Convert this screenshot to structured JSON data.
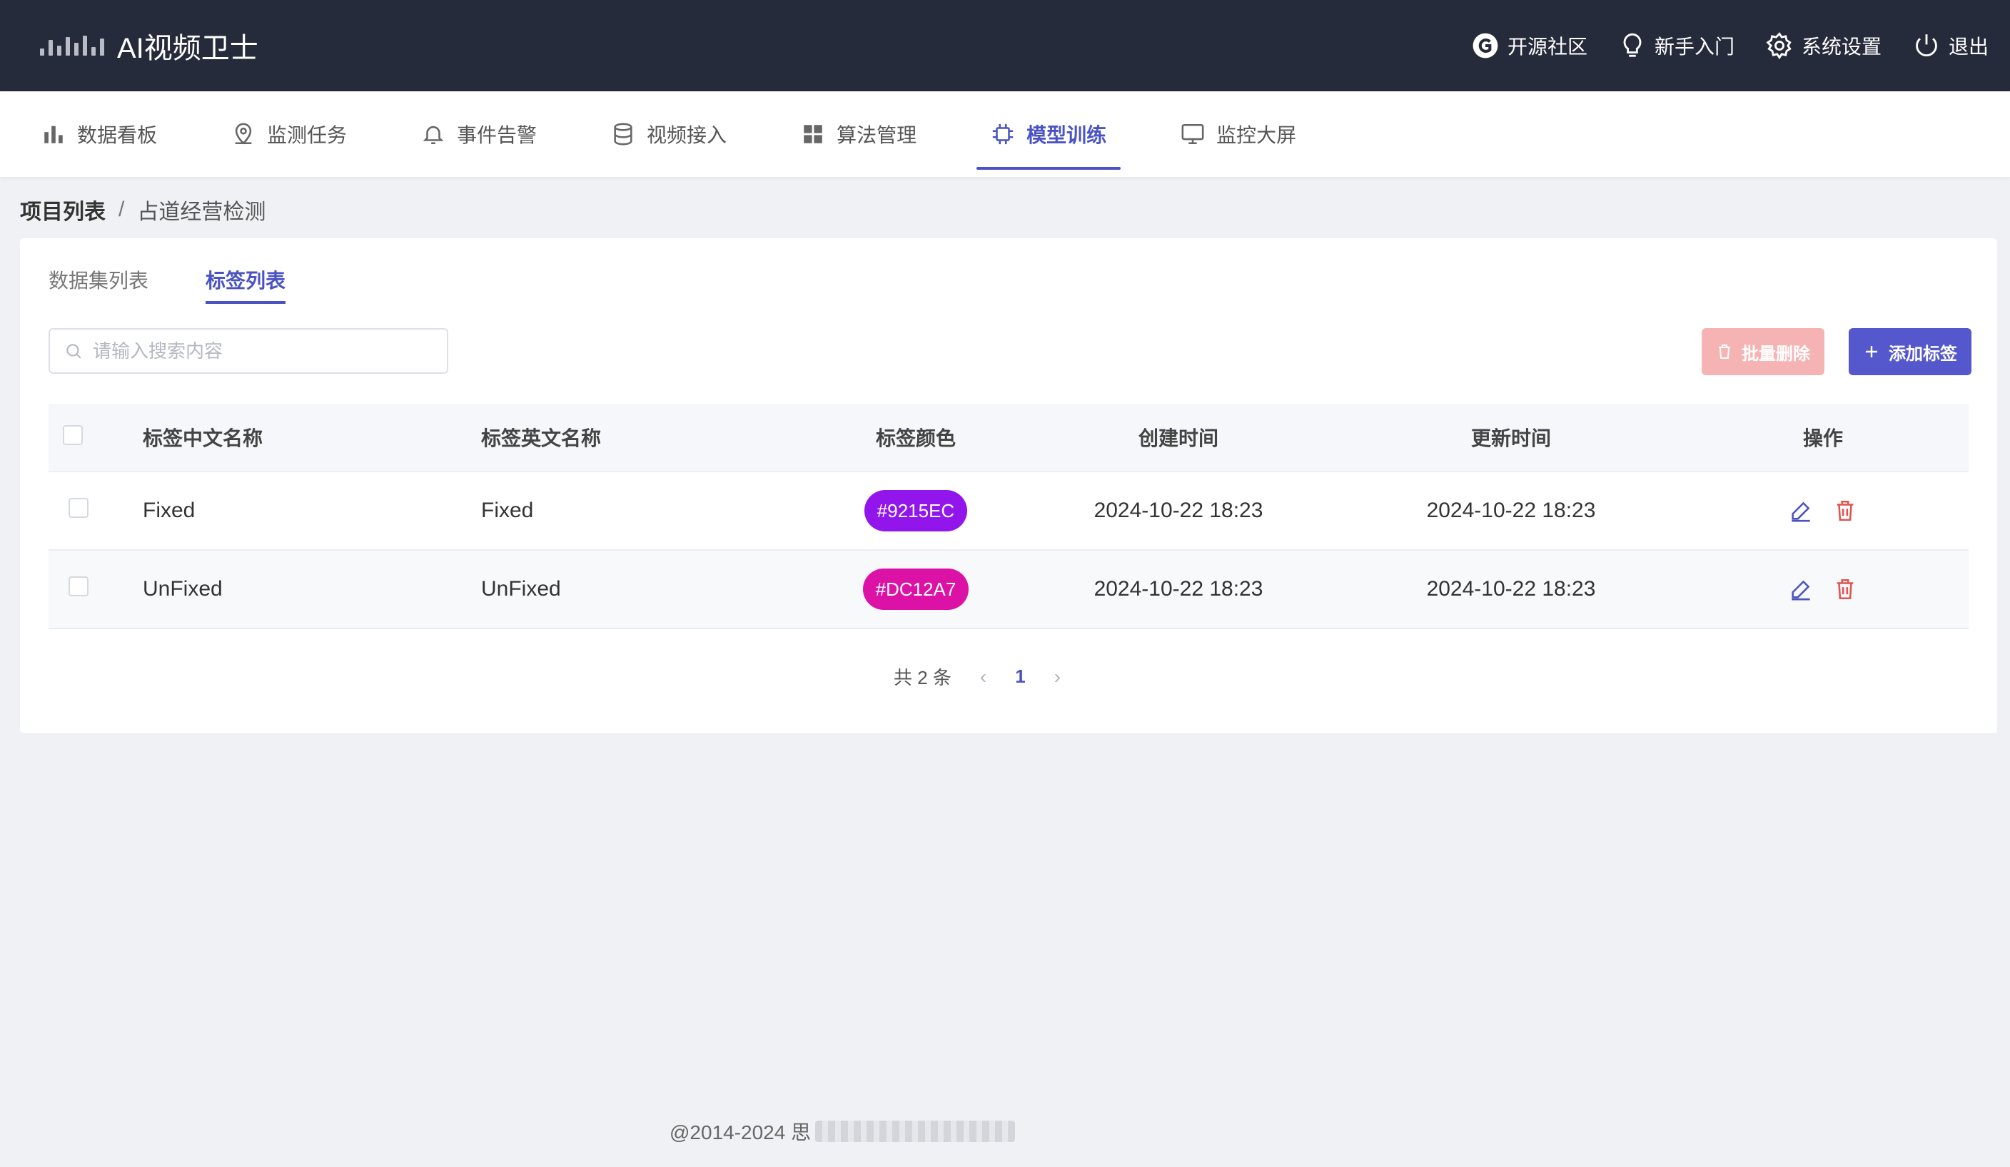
{
  "header": {
    "brand_prefix": "AI",
    "brand_title": "AI视频卫士",
    "actions": [
      {
        "label": "开源社区",
        "icon": "community-icon"
      },
      {
        "label": "新手入门",
        "icon": "lightbulb-icon"
      },
      {
        "label": "系统设置",
        "icon": "gear-icon"
      },
      {
        "label": "退出",
        "icon": "power-icon"
      }
    ]
  },
  "nav": {
    "items": [
      {
        "label": "数据看板",
        "icon": "bar-chart-icon"
      },
      {
        "label": "监测任务",
        "icon": "location-pin-icon"
      },
      {
        "label": "事件告警",
        "icon": "bell-icon"
      },
      {
        "label": "视频接入",
        "icon": "database-icon"
      },
      {
        "label": "算法管理",
        "icon": "grid-icon"
      },
      {
        "label": "模型训练",
        "icon": "chip-icon"
      },
      {
        "label": "监控大屏",
        "icon": "monitor-icon"
      }
    ],
    "active": "模型训练"
  },
  "breadcrumb": {
    "root": "项目列表",
    "separator": "/",
    "current": "占道经营检测"
  },
  "tabs": [
    {
      "label": "数据集列表",
      "active": false
    },
    {
      "label": "标签列表",
      "active": true
    }
  ],
  "search": {
    "placeholder": "请输入搜索内容",
    "value": ""
  },
  "buttons": {
    "batch_delete": "批量删除",
    "add_label": "添加标签"
  },
  "table": {
    "headers": {
      "cn_name": "标签中文名称",
      "en_name": "标签英文名称",
      "color": "标签颜色",
      "created": "创建时间",
      "updated": "更新时间",
      "ops": "操作"
    },
    "rows": [
      {
        "cn_name": "Fixed",
        "en_name": "Fixed",
        "color": "#9215EC",
        "created": "2024-10-22 18:23",
        "updated": "2024-10-22 18:23"
      },
      {
        "cn_name": "UnFixed",
        "en_name": "UnFixed",
        "color": "#DC12A7",
        "created": "2024-10-22 18:23",
        "updated": "2024-10-22 18:23"
      }
    ]
  },
  "pagination": {
    "total_text": "共 2 条",
    "current_page": "1",
    "prev": "‹",
    "next": "›"
  },
  "footer": {
    "copyright": "@2014-2024 思"
  },
  "colors": {
    "accent": "#4b53c4",
    "header_bg": "#262b3b",
    "danger": "#e0534f"
  }
}
